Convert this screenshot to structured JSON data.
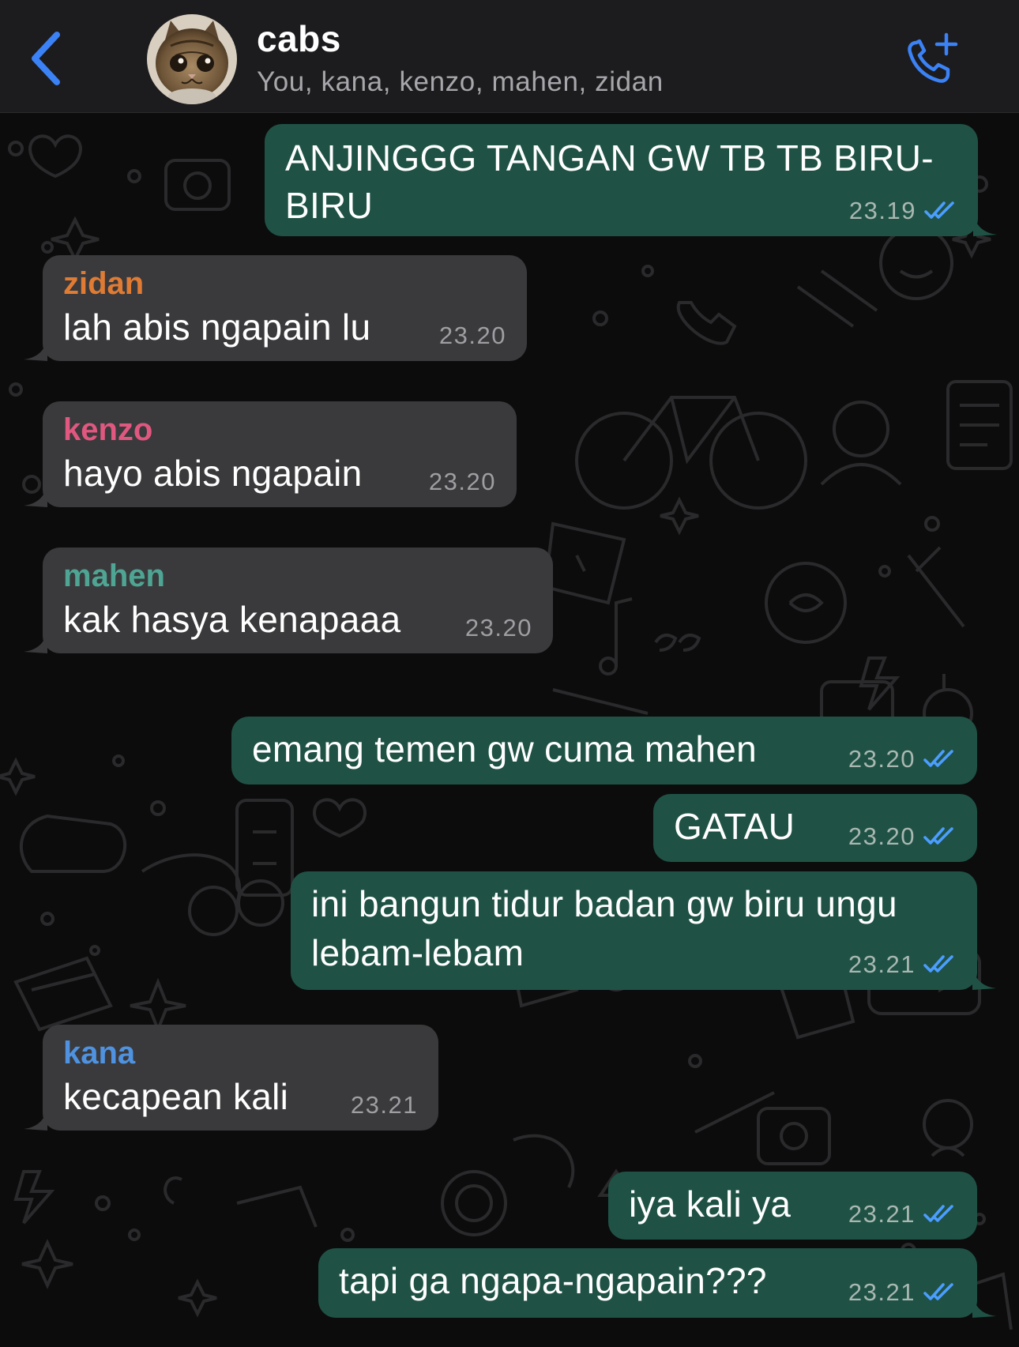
{
  "header": {
    "title": "cabs",
    "subtitle": "You, kana, kenzo, mahen, zidan"
  },
  "colors": {
    "outgoing_bubble": "#1f5245",
    "incoming_bubble": "#3a3a3c",
    "accent_blue": "#3b82f6",
    "zidan": "#e07b34",
    "kenzo": "#e0577f",
    "mahen": "#4fa593",
    "kana": "#4f92e0"
  },
  "messages": [
    {
      "dir": "out",
      "lines": [
        "ANJINGGG TANGAN GW TB TB BIRU-",
        "BIRU"
      ],
      "time": "23.19",
      "read_icon": "double-check-icon"
    },
    {
      "dir": "in",
      "sender": "zidan",
      "lines": [
        "lah abis ngapain lu"
      ],
      "time": "23.20"
    },
    {
      "dir": "in",
      "sender": "kenzo",
      "lines": [
        "hayo abis ngapain"
      ],
      "time": "23.20"
    },
    {
      "dir": "in",
      "sender": "mahen",
      "lines": [
        "kak hasya kenapaaa"
      ],
      "time": "23.20"
    },
    {
      "dir": "out",
      "lines": [
        "emang temen gw cuma mahen"
      ],
      "time": "23.20",
      "read_icon": "double-check-icon"
    },
    {
      "dir": "out",
      "lines": [
        "GATAU"
      ],
      "time": "23.20",
      "read_icon": "double-check-icon"
    },
    {
      "dir": "out",
      "lines": [
        "ini bangun tidur badan gw biru ungu",
        "lebam-lebam"
      ],
      "time": "23.21",
      "read_icon": "double-check-icon"
    },
    {
      "dir": "in",
      "sender": "kana",
      "lines": [
        "kecapean kali"
      ],
      "time": "23.21"
    },
    {
      "dir": "out",
      "lines": [
        "iya kali ya"
      ],
      "time": "23.21",
      "read_icon": "double-check-icon"
    },
    {
      "dir": "out",
      "lines": [
        "tapi ga ngapa-ngapain???"
      ],
      "time": "23.21",
      "read_icon": "double-check-icon"
    }
  ]
}
